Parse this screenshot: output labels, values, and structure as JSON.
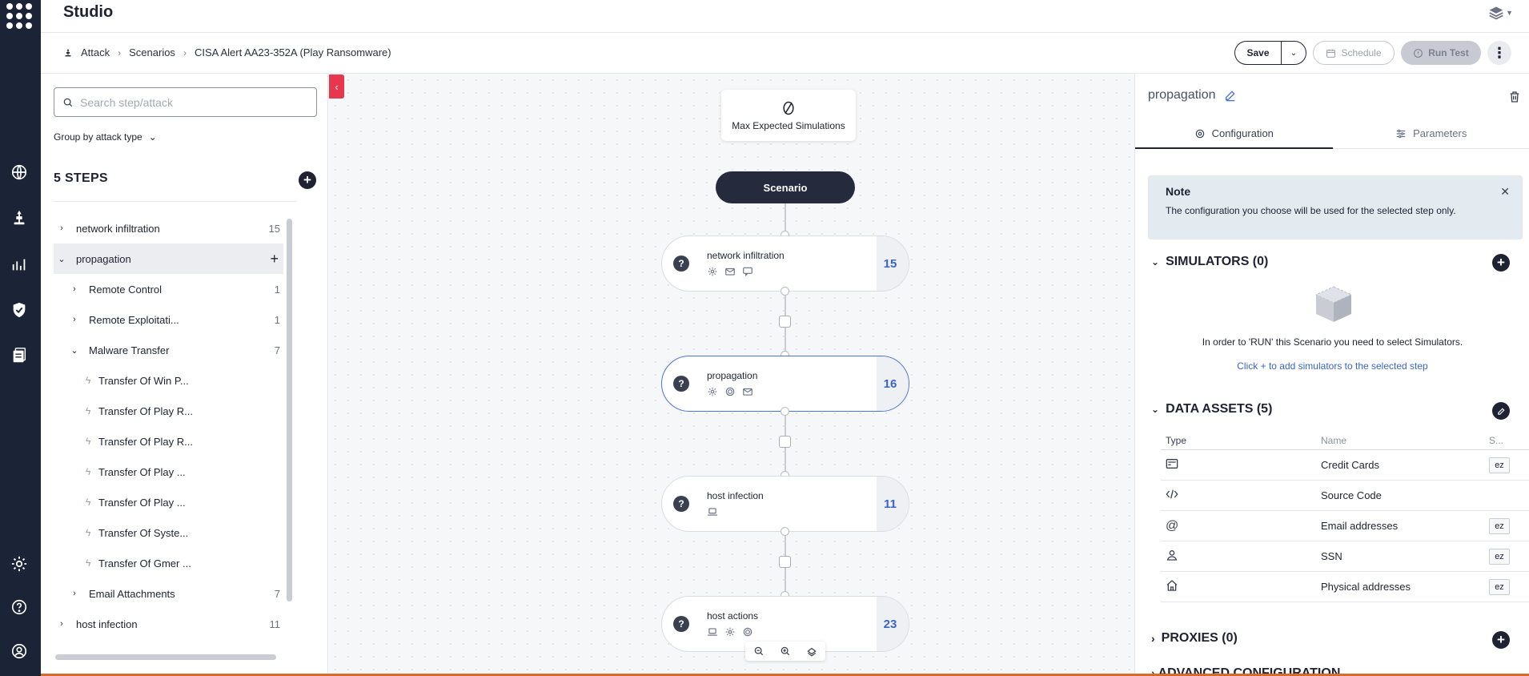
{
  "app": {
    "title": "Studio"
  },
  "breadcrumb": {
    "items": [
      "Attack",
      "Scenarios",
      "CISA Alert AA23-352A (Play Ransomware)"
    ]
  },
  "toolbar": {
    "save_label": "Save",
    "schedule_label": "Schedule",
    "run_label": "Run Test"
  },
  "steps_panel": {
    "search_placeholder": "Search step/attack",
    "group_by_label": "Group by attack type",
    "title": "5 STEPS",
    "tree": [
      {
        "label": "network infiltration",
        "count": "15",
        "level": 0,
        "chev": "›"
      },
      {
        "label": "propagation",
        "count": "",
        "level": 0,
        "chev": "⌄",
        "active": true
      },
      {
        "label": "Remote Control",
        "count": "1",
        "level": 1,
        "chev": "›"
      },
      {
        "label": "Remote Exploitati...",
        "count": "1",
        "level": 1,
        "chev": "›"
      },
      {
        "label": "Malware Transfer",
        "count": "7",
        "level": 1,
        "chev": "⌄"
      },
      {
        "label": "Transfer Of Win P...",
        "level": 2
      },
      {
        "label": "Transfer Of Play R...",
        "level": 2
      },
      {
        "label": "Transfer Of Play R...",
        "level": 2
      },
      {
        "label": "Transfer Of Play ...",
        "level": 2
      },
      {
        "label": "Transfer Of Play ...",
        "level": 2
      },
      {
        "label": "Transfer Of Syste...",
        "level": 2
      },
      {
        "label": "Transfer Of Gmer ...",
        "level": 2
      },
      {
        "label": "Email Attachments",
        "count": "7",
        "level": 1,
        "chev": "›"
      },
      {
        "label": "host infection",
        "count": "11",
        "level": 0,
        "chev": "›"
      }
    ]
  },
  "canvas": {
    "max_sim_label": "Max Expected Simulations",
    "scenario_label": "Scenario",
    "steps": [
      {
        "name": "network infiltration",
        "count": "15",
        "icons": [
          "gear-icon",
          "mail-icon",
          "chat-icon"
        ]
      },
      {
        "name": "propagation",
        "count": "16",
        "icons": [
          "gear-icon",
          "target-icon",
          "mail-icon"
        ],
        "selected": true
      },
      {
        "name": "host infection",
        "count": "11",
        "icons": [
          "laptop-icon"
        ]
      },
      {
        "name": "host actions",
        "count": "23",
        "icons": [
          "laptop-icon",
          "gear-icon",
          "target-icon"
        ]
      }
    ]
  },
  "config": {
    "title": "propagation",
    "tabs": [
      "Configuration",
      "Parameters"
    ],
    "note": {
      "title": "Note",
      "body": "The configuration you choose will be used for the selected step only."
    },
    "simulators": {
      "heading": "SIMULATORS (0)",
      "message": "In order to 'RUN' this Scenario you need to select Simulators.",
      "link": "Click + to add simulators to the selected step"
    },
    "data_assets": {
      "heading": "DATA ASSETS (5)",
      "columns": [
        "Type",
        "Name",
        "S..."
      ],
      "rows": [
        {
          "icon": "credit-card-icon",
          "name": "Credit Cards",
          "tag": "ez"
        },
        {
          "icon": "code-icon",
          "name": "Source Code",
          "tag": ""
        },
        {
          "icon": "at-icon",
          "name": "Email addresses",
          "tag": "ez"
        },
        {
          "icon": "person-icon",
          "name": "SSN",
          "tag": "ez"
        },
        {
          "icon": "home-icon",
          "name": "Physical addresses",
          "tag": "ez"
        }
      ]
    },
    "proxies": {
      "heading": "PROXIES (0)"
    },
    "advanced": {
      "heading": "ADVANCED CONFIGURATION"
    }
  }
}
